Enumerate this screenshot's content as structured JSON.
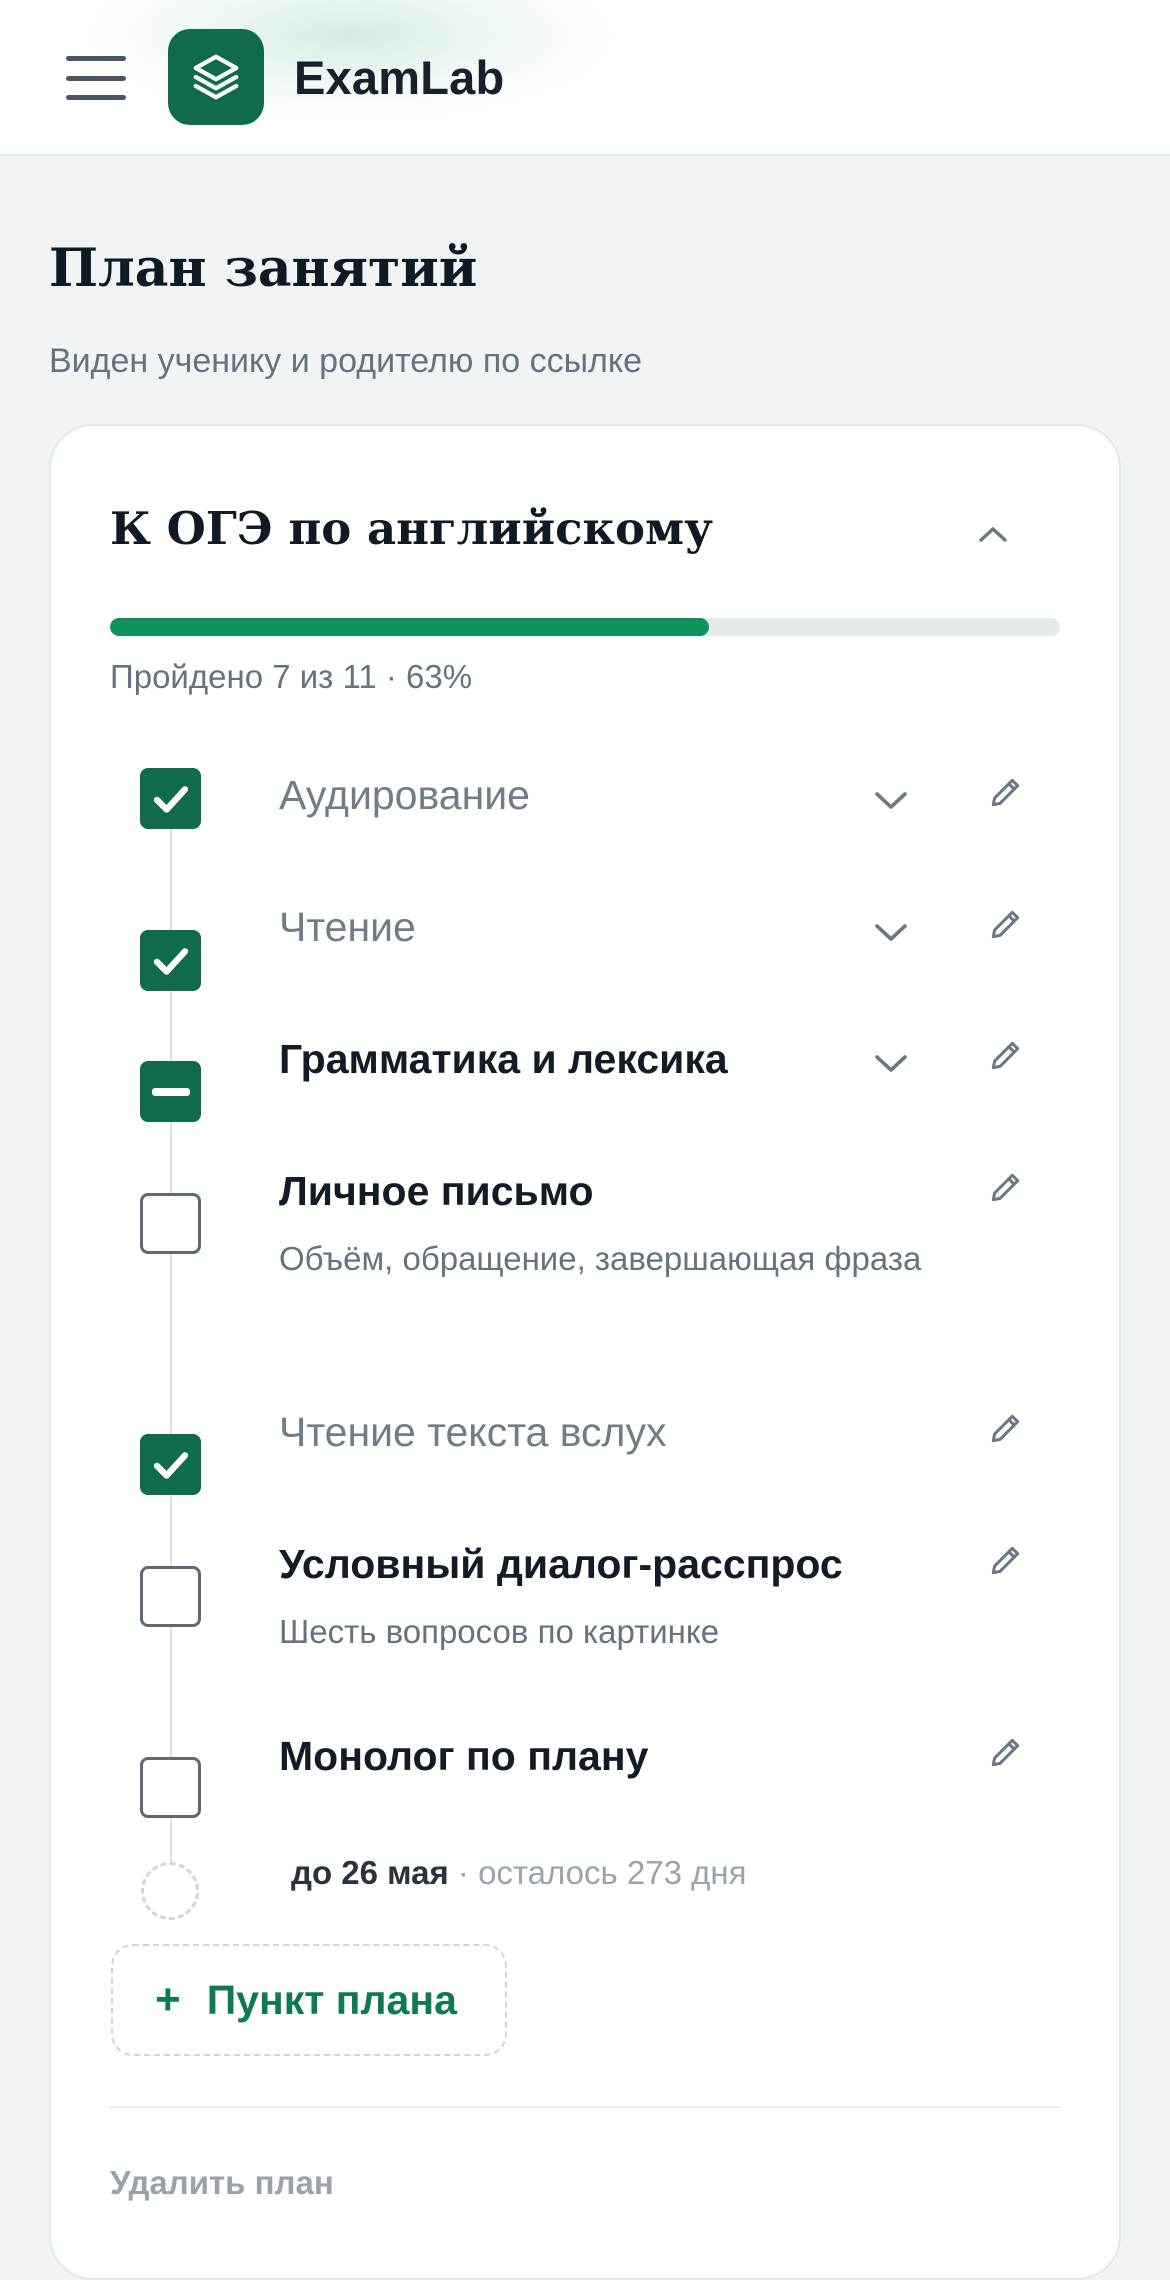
{
  "header": {
    "menu_icon": "hamburger-icon",
    "logo_icon": "layers-icon",
    "brand": "ExamLab",
    "brand_color": "#0f6b4b"
  },
  "page": {
    "title": "План занятий",
    "subtitle": "Виден ученику и родителю по ссылке"
  },
  "plan": {
    "title": "К ОГЭ по английскому",
    "collapse_icon": "chevron-up-icon",
    "progress": {
      "done": 7,
      "total": 11,
      "percent": 63,
      "text": "Пройдено 7 из 11 · 63%",
      "fill_color": "#0f9160"
    },
    "items": [
      {
        "label": "Аудирование",
        "state": "checked",
        "expandable": true,
        "description": ""
      },
      {
        "label": "Чтение",
        "state": "checked",
        "expandable": true,
        "description": ""
      },
      {
        "label": "Грамматика и лексика",
        "state": "partial",
        "expandable": true,
        "description": ""
      },
      {
        "label": "Личное письмо",
        "state": "unchecked",
        "expandable": false,
        "description": "Объём, обращение, завершающая фраза"
      },
      {
        "label": "Чтение текста вслух",
        "state": "checked",
        "expandable": false,
        "description": ""
      },
      {
        "label": "Условный диалог-расспрос",
        "state": "unchecked",
        "expandable": false,
        "description": "Шесть вопросов по картинке"
      },
      {
        "label": "Монолог по плану",
        "state": "unchecked",
        "expandable": false,
        "description": ""
      }
    ],
    "deadline": {
      "date": "до 26 мая",
      "separator": "·",
      "remaining": "осталось 273 дня"
    },
    "add_button": {
      "icon": "+",
      "label": "Пункт плана"
    },
    "delete_label": "Удалить план"
  }
}
